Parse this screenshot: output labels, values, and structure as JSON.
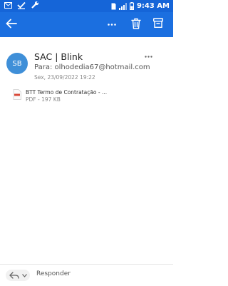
{
  "status_bar": {
    "time": "9:43 AM",
    "left_icons": [
      "mail-notification-icon",
      "check-icon",
      "wrench-icon"
    ],
    "right_icons": [
      "sim-icon",
      "signal-icon",
      "battery-icon"
    ]
  },
  "app_bar": {
    "icons": [
      "back-arrow-icon",
      "more-icon",
      "trash-icon",
      "archive-icon"
    ],
    "color": "#1b6fe0"
  },
  "message": {
    "avatar_initials": "SB",
    "sender": "SAC | Blink",
    "to": "Para: olhodedia67@hotmail.com",
    "date": "Sex, 23/09/2022 19:22"
  },
  "attachment": {
    "name": "BTT Termo de Contratação - ...",
    "meta": "PDF - 197 KB"
  },
  "bottom_bar": {
    "reply_label": "Responder"
  }
}
